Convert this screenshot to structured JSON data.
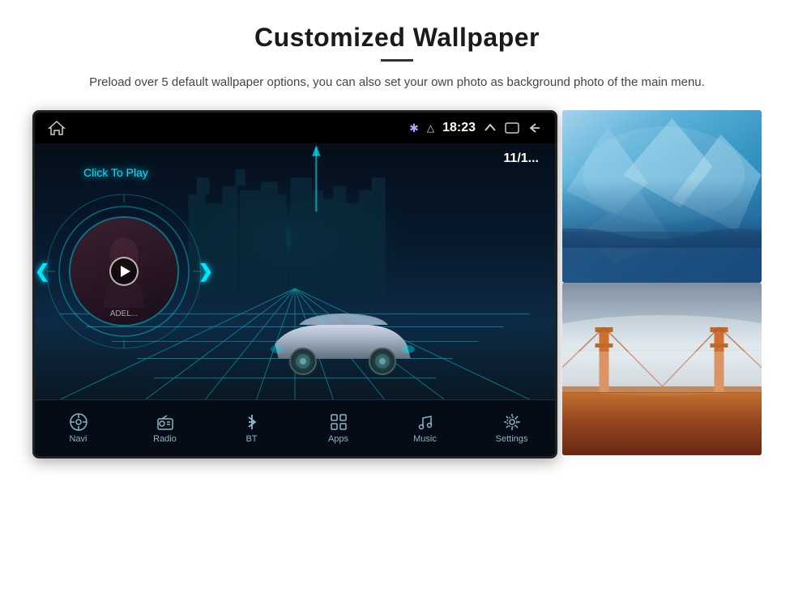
{
  "header": {
    "title": "Customized Wallpaper",
    "subtitle": "Preload over 5 default wallpaper options, you can also set your own photo as background photo of the main menu."
  },
  "screen": {
    "status_bar": {
      "time": "18:23"
    },
    "music": {
      "click_to_play": "Click To Play",
      "artist": "ADEL...",
      "date": "11/1..."
    },
    "nav_items": [
      {
        "label": "Navi",
        "icon": "navi"
      },
      {
        "label": "Radio",
        "icon": "radio"
      },
      {
        "label": "BT",
        "icon": "bluetooth"
      },
      {
        "label": "Apps",
        "icon": "apps"
      },
      {
        "label": "Music",
        "icon": "music"
      },
      {
        "label": "Settings",
        "icon": "settings"
      }
    ]
  },
  "thumbnails": [
    {
      "id": "ice",
      "alt": "Ice/glacier wallpaper"
    },
    {
      "id": "bridge",
      "alt": "Golden Gate Bridge wallpaper"
    }
  ]
}
